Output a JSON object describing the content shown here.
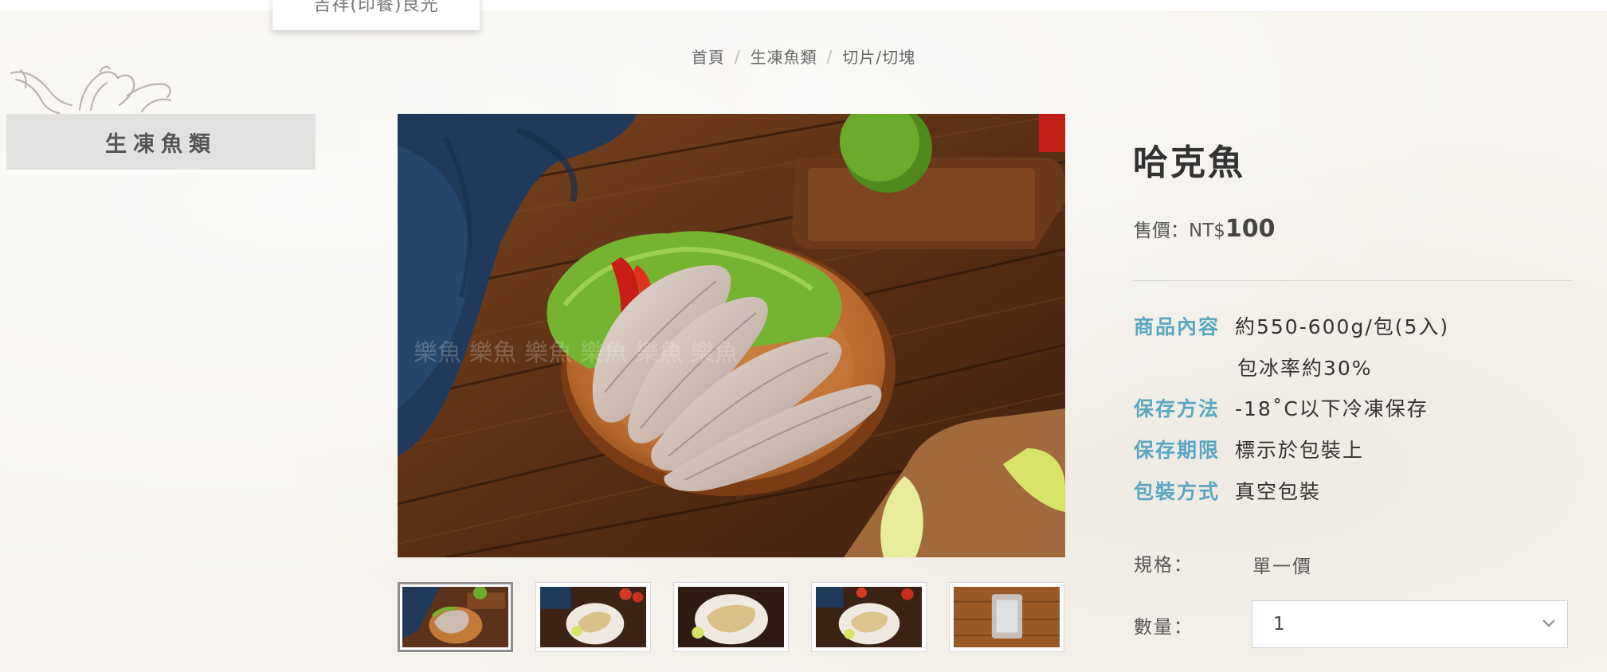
{
  "top_dropdown": {
    "label": "吉祥(印餐)良光"
  },
  "breadcrumb": {
    "items": [
      {
        "label": "首頁"
      },
      {
        "label": "生凍魚類"
      },
      {
        "label": "切片/切塊"
      }
    ],
    "separator": "/"
  },
  "sidebar": {
    "logo_icon": "fish-chicken-logo-icon",
    "category_label": "生凍魚類"
  },
  "gallery": {
    "main_image": "fried-fish-fillets-on-wooden-plate",
    "thumbnail_count": 5,
    "active_thumbnail": 1
  },
  "product": {
    "title": "哈克魚",
    "price_label": "售價：NT$",
    "price_value": "100",
    "specs": [
      {
        "label": "商品內容",
        "value": "約550-600g/包(5入)",
        "value2": "包冰率約30%"
      },
      {
        "label": "保存方法",
        "value": "-18˚C以下冷凍保存"
      },
      {
        "label": "保存期限",
        "value": "標示於包裝上"
      },
      {
        "label": "包裝方式",
        "value": "真空包裝"
      }
    ],
    "variant_label": "規格：",
    "variant_value": "單一價",
    "quantity_label": "數量：",
    "quantity_value": "1"
  },
  "colors": {
    "accent": "#5aa7c2",
    "sidebar_bg": "#e2e1df",
    "page_bg": "#f6f3ee"
  }
}
